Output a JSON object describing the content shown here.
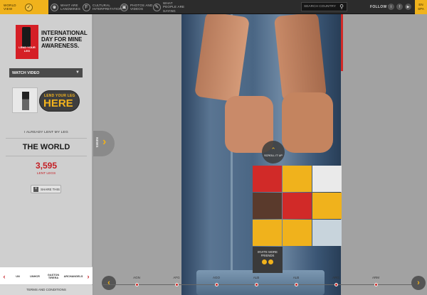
{
  "nav": {
    "items": [
      {
        "label": "World view",
        "icon": "running-man-icon",
        "active": true
      },
      {
        "label": "What are landmines",
        "icon": "mine-icon"
      },
      {
        "label": "Cultural interpretation",
        "icon": "facebook-icon"
      },
      {
        "label": "Photos and videos",
        "icon": "camera-icon"
      },
      {
        "label": "What people are saying",
        "icon": "speech-bubble-icon"
      }
    ],
    "search_placeholder": "SEARCH COUNTRY",
    "follow_label": "FOLLOW US",
    "lang_top": "EN",
    "lang_bottom": "SPA",
    "accent": "#f0b21c"
  },
  "sidebar": {
    "logo_text": "LEND YOUR LEG",
    "headline": "INTERNATIONAL DAY FOR MINE AWARENESS.",
    "watch_video": "WATCH VIDEO",
    "lend_small": "LEND YOUR LEG",
    "lend_big": "HERE",
    "already": "I ALREADY LENT MY LEG",
    "world": "THE WORLD",
    "count": "3,595",
    "count_label": "LENT LEGS",
    "share": "SHARE THIS",
    "partners": [
      "UN",
      "UNHCR",
      "GASTON TIRERA",
      "ARCHANGELS"
    ],
    "terms": "TERMS AND CONDITIONS",
    "count_color": "#c41e24"
  },
  "main": {
    "scroll_label": "SCROLL IT UP",
    "invite": "INVITE MORE FRIENDS",
    "news": "NEWS"
  },
  "timeline": {
    "countries": [
      "AGN",
      "AFG",
      "AGO",
      "ALB",
      "ALB",
      "ARG",
      "ARM"
    ]
  }
}
